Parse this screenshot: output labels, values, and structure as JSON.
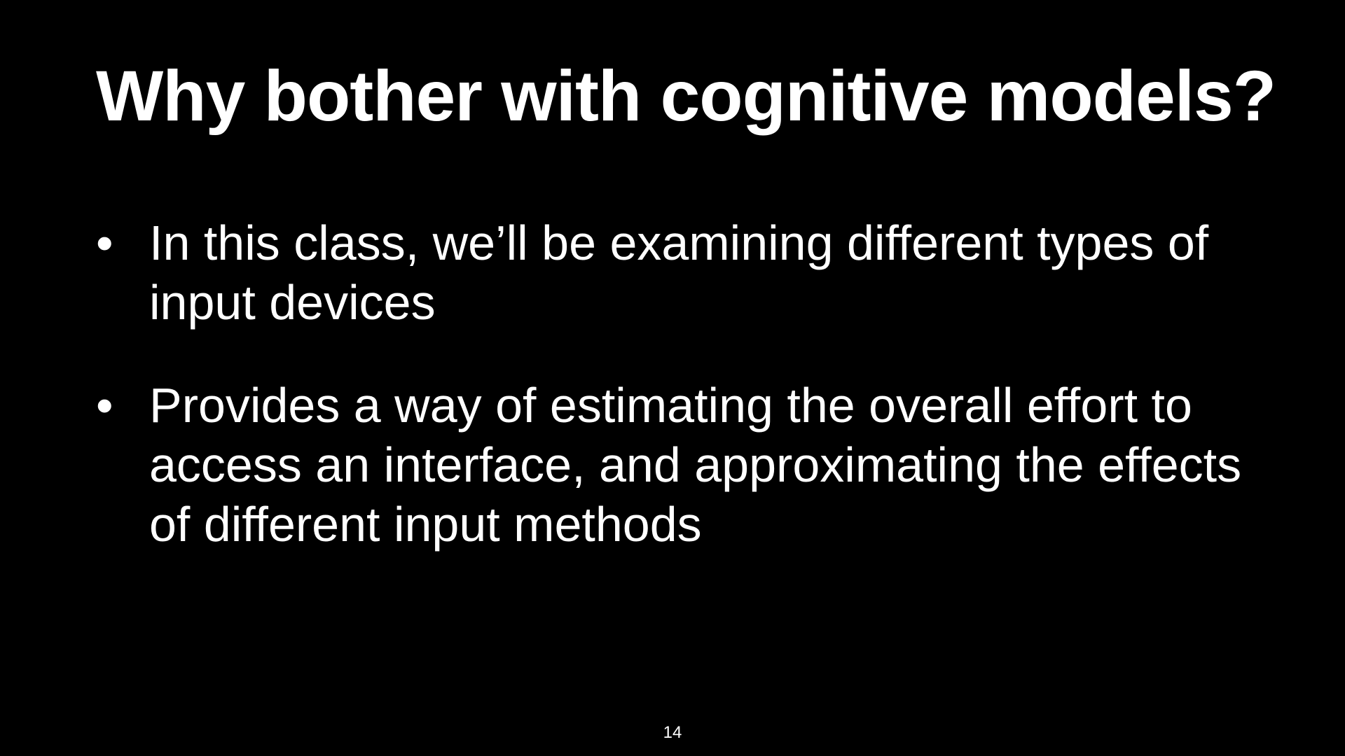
{
  "slide": {
    "title": "Why bother with cognitive models?",
    "bullets": [
      {
        "marker": "•",
        "text": "In this class, we’ll be examining different types of input devices"
      },
      {
        "marker": "•",
        "text": "Provides a way of estimating the overall effort to access an interface, and approximating the effects of different input methods"
      }
    ],
    "page_number": "14"
  },
  "colors": {
    "background": "#000000",
    "text": "#ffffff"
  }
}
